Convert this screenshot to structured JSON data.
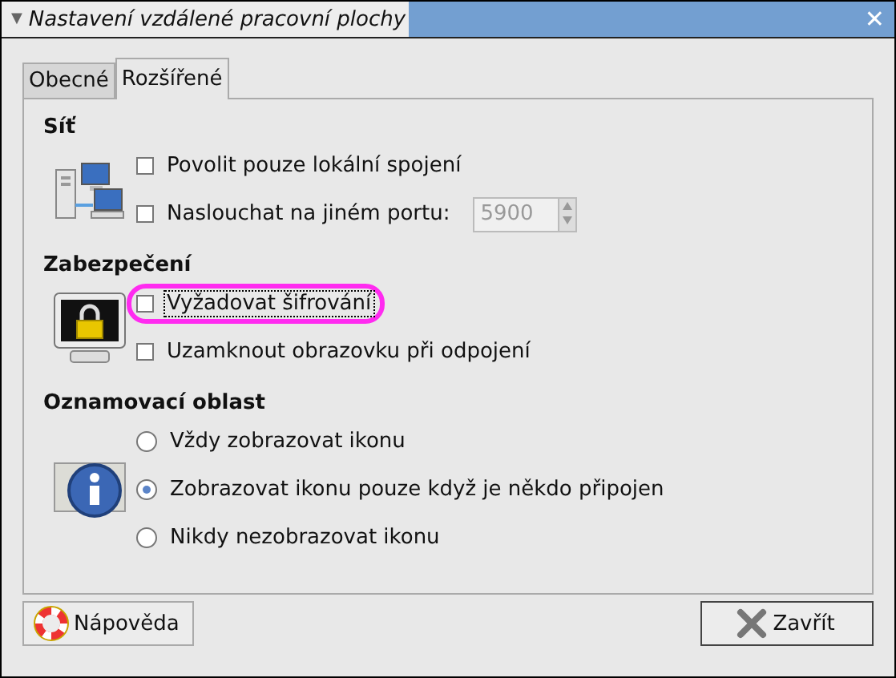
{
  "window": {
    "title": "Nastavení vzdálené pracovní plochy",
    "collapse_glyph": "▼",
    "close_glyph": "✕"
  },
  "tabs": [
    {
      "label": "Obecné",
      "selected": false
    },
    {
      "label": "Rozšířené",
      "selected": true
    }
  ],
  "sections": [
    {
      "title": "Síť",
      "rows": [
        {
          "kind": "checkbox",
          "label": "Povolit pouze lokální spojení",
          "checked": false,
          "highlighted": false
        },
        {
          "kind": "checkbox-spin",
          "label": "Naslouchat na jiném portu:",
          "checked": false,
          "highlighted": false,
          "value": "5900",
          "disabled": true
        }
      ]
    },
    {
      "title": "Zabezpečení",
      "rows": [
        {
          "kind": "checkbox",
          "label": "Vyžadovat šifrování",
          "checked": false,
          "highlighted": true
        },
        {
          "kind": "checkbox",
          "label": "Uzamknout obrazovku při odpojení",
          "checked": false,
          "highlighted": false
        }
      ]
    },
    {
      "title": "Oznamovací oblast",
      "rows": [
        {
          "kind": "radio",
          "label": "Vždy zobrazovat ikonu",
          "selected": false
        },
        {
          "kind": "radio",
          "label": "Zobrazovat ikonu pouze když je někdo připojen",
          "selected": true
        },
        {
          "kind": "radio",
          "label": "Nikdy nezobrazovat ikonu",
          "selected": false
        }
      ]
    }
  ],
  "buttons": [
    {
      "label": "Nápověda",
      "kind": "help"
    },
    {
      "label": "Zavřít",
      "kind": "close"
    }
  ]
}
